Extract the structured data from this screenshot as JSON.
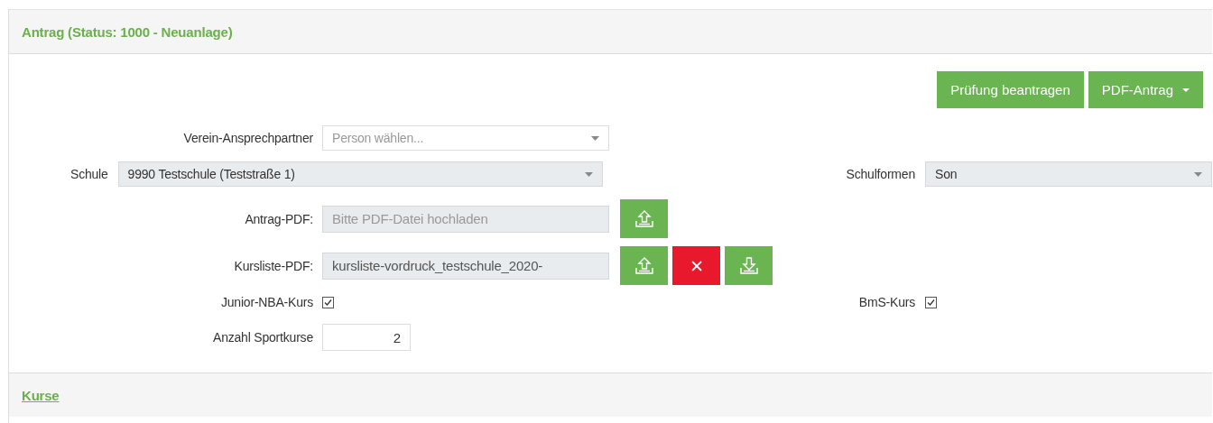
{
  "panel": {
    "title": "Antrag (Status: 1000 - Neuanlage)"
  },
  "actions": [
    {
      "label": "Prüfung beantragen",
      "kind": "button"
    },
    {
      "label": "PDF-Antrag",
      "kind": "dropdown"
    }
  ],
  "contact": {
    "label": "Verein-Ansprechpartner",
    "placeholder": "Person wählen..."
  },
  "school": {
    "label": "Schule",
    "value": "9990 Testschule (Teststraße 1)"
  },
  "school_types": {
    "label": "Schulformen",
    "value": "Son"
  },
  "files": [
    {
      "label": "Antrag-PDF:",
      "placeholder": "Bitte PDF-Datei hochladen",
      "buttons": [
        {
          "kind": "upload"
        }
      ]
    },
    {
      "label": "Kursliste-PDF:",
      "value": "kursliste-vordruck_testschule_2020-",
      "buttons": [
        {
          "kind": "upload"
        },
        {
          "kind": "delete"
        },
        {
          "kind": "download"
        }
      ]
    }
  ],
  "checkboxes": [
    {
      "label": "Junior-NBA-Kurs",
      "checked": true
    },
    {
      "label": "BmS-Kurs",
      "checked": true
    }
  ],
  "course_count": {
    "label": "Anzahl Sportkurse",
    "value": "2"
  },
  "footer": {
    "link": "Kurse"
  }
}
